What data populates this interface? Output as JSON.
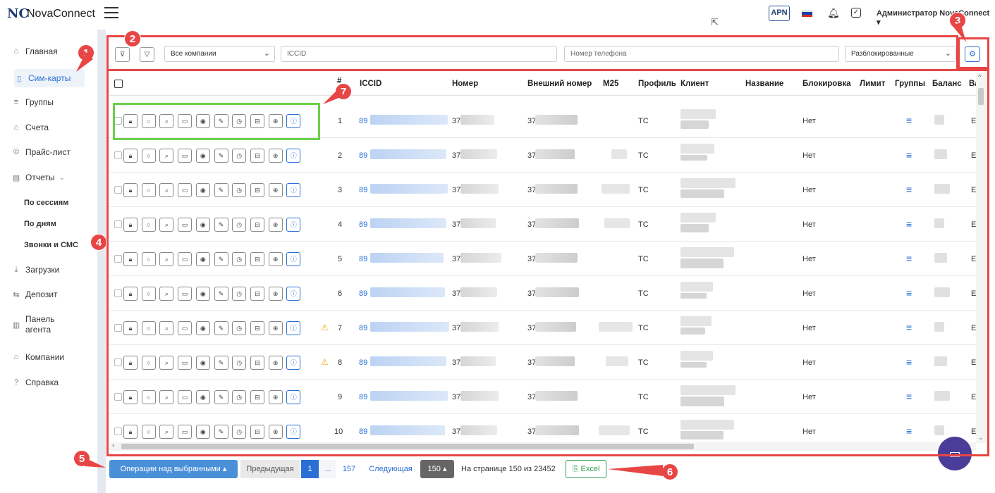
{
  "app": {
    "logo_mark": "NC",
    "name": "NovaConnect"
  },
  "topbar": {
    "apn": "APN",
    "user": "Администратор NovaConnect ▾",
    "flag_colors": [
      "#ffffff",
      "#1c3faa",
      "#d52b1e"
    ]
  },
  "sidebar": {
    "items": [
      {
        "label": "Главная",
        "icon": "home-icon",
        "glyph": "⌂"
      },
      {
        "label": "Сим-карты",
        "icon": "sim-icon",
        "glyph": "▯"
      },
      {
        "label": "Группы",
        "icon": "stack-icon",
        "glyph": "≡"
      },
      {
        "label": "Счета",
        "icon": "bank-icon",
        "glyph": "⌂"
      },
      {
        "label": "Прайс-лист",
        "icon": "price-icon",
        "glyph": "©"
      },
      {
        "label": "Отчеты",
        "icon": "report-icon",
        "glyph": "▤"
      },
      {
        "label": "Загрузки",
        "icon": "download-icon",
        "glyph": "⤓"
      },
      {
        "label": "Депозит",
        "icon": "deposit-icon",
        "glyph": "⇆"
      },
      {
        "label": "Панель агента",
        "icon": "chart-icon",
        "glyph": "▥"
      },
      {
        "label": "Компании",
        "icon": "building-icon",
        "glyph": "⌂"
      },
      {
        "label": "Справка",
        "icon": "help-icon",
        "glyph": "?"
      }
    ],
    "reports_chevron": "⌄",
    "sub_items": [
      "По сессиям",
      "По дням",
      "Звонки и СМС"
    ]
  },
  "filters": {
    "company": "Все компании",
    "iccid_placeholder": "ICCID",
    "phone_placeholder": "Номер телефона",
    "status": "Разблокированные"
  },
  "table": {
    "columns": [
      "#",
      "ICCID",
      "Номер",
      "Внешний номер",
      "M25",
      "Профиль",
      "Клиент",
      "Название",
      "Блокировка",
      "Лимит",
      "Группы",
      "Баланс",
      "Ва"
    ],
    "rows": [
      {
        "num": "1",
        "iccid": "89",
        "number": "372",
        "ext": "37.",
        "profile": "TC",
        "block": "Нет",
        "last": "EU",
        "warn": ""
      },
      {
        "num": "2",
        "iccid": "89",
        "number": "372",
        "ext": "37.",
        "profile": "TC",
        "block": "Нет",
        "last": "EU",
        "warn": ""
      },
      {
        "num": "3",
        "iccid": "89",
        "number": "372",
        "ext": "37.",
        "profile": "TC",
        "block": "Нет",
        "last": "EU",
        "warn": ""
      },
      {
        "num": "4",
        "iccid": "89",
        "number": "372",
        "ext": "37.",
        "profile": "TC",
        "block": "Нет",
        "last": "EU",
        "warn": ""
      },
      {
        "num": "5",
        "iccid": "89",
        "number": "372",
        "ext": "37.",
        "profile": "TC",
        "block": "Нет",
        "last": "EU",
        "warn": ""
      },
      {
        "num": "6",
        "iccid": "89",
        "number": "372",
        "ext": "37.",
        "profile": "TC",
        "block": "Нет",
        "last": "EU",
        "warn": ""
      },
      {
        "num": "7",
        "iccid": "89",
        "number": "372",
        "ext": "37.",
        "profile": "TC",
        "block": "Нет",
        "last": "EU",
        "warn": "⚠"
      },
      {
        "num": "8",
        "iccid": "89",
        "number": "372",
        "ext": "37.",
        "profile": "TC",
        "block": "Нет",
        "last": "EU",
        "warn": "⚠"
      },
      {
        "num": "9",
        "iccid": "89",
        "number": "372",
        "ext": "37.",
        "profile": "TC",
        "block": "Нет",
        "last": "EU",
        "warn": ""
      },
      {
        "num": "10",
        "iccid": "89",
        "number": "372",
        "ext": "37.",
        "profile": "TC",
        "block": "Нет",
        "last": "EU",
        "warn": ""
      }
    ],
    "row_actions": [
      {
        "icon": "lock-icon",
        "glyph": "🔒︎"
      },
      {
        "icon": "refresh-icon",
        "glyph": "○"
      },
      {
        "icon": "search-icon",
        "glyph": "⌕"
      },
      {
        "icon": "sim-card-icon",
        "glyph": "▭"
      },
      {
        "icon": "coin-icon",
        "glyph": "◉"
      },
      {
        "icon": "edit-icon",
        "glyph": "✎"
      },
      {
        "icon": "clock-icon",
        "glyph": "◷"
      },
      {
        "icon": "bag-icon",
        "glyph": "⊟"
      },
      {
        "icon": "globe-icon",
        "glyph": "⊕"
      },
      {
        "icon": "info-icon",
        "glyph": "ⓘ"
      }
    ],
    "groups_glyph": "≡"
  },
  "pagination": {
    "bulk_ops": "Операции над выбранными ▴",
    "prev": "Предыдущая",
    "current": "1",
    "ellipsis": "...",
    "last": "157",
    "next": "Следующая",
    "per_page": "150 ▴",
    "summary": "На странице 150 из 23452",
    "excel": "Excel"
  },
  "annotations": {
    "markers": [
      "1",
      "2",
      "3",
      "4",
      "5",
      "6",
      "7"
    ],
    "color": "#e84545",
    "highlight_color": "#6ad04a"
  },
  "colors": {
    "accent": "#2a6fd6",
    "chat": "#4a3d9a",
    "sidebar_strip": "#e4e9f0"
  }
}
